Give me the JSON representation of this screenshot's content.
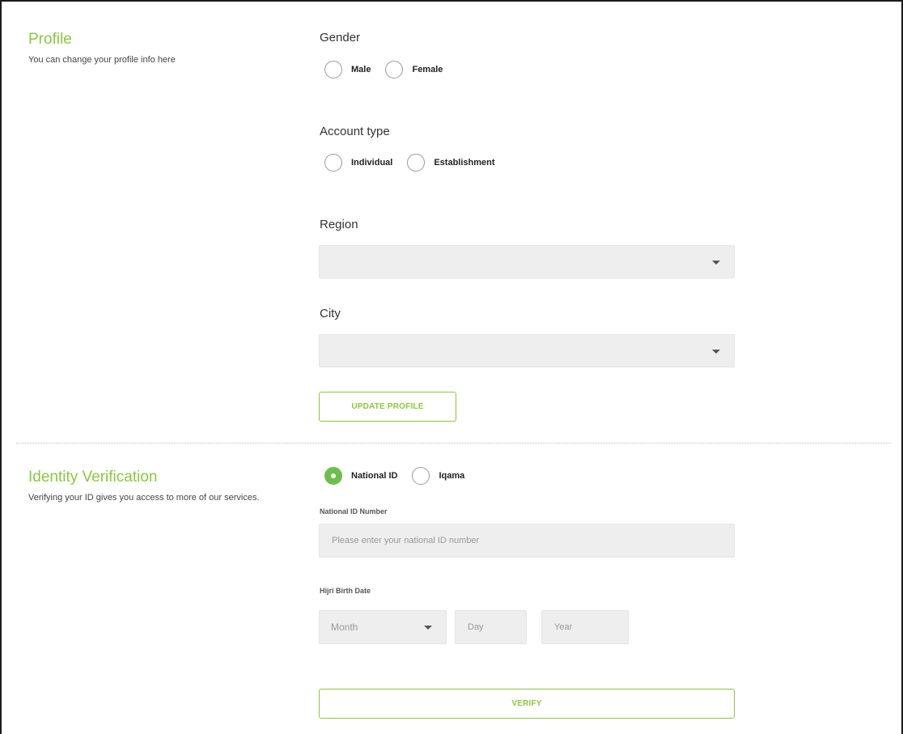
{
  "profile": {
    "title": "Profile",
    "description": "You can change your profile info here",
    "gender": {
      "label": "Gender",
      "options": [
        {
          "label": "Male",
          "checked": false
        },
        {
          "label": "Female",
          "checked": false
        }
      ]
    },
    "account_type": {
      "label": "Account type",
      "options": [
        {
          "label": "Individual",
          "checked": false
        },
        {
          "label": "Establishment",
          "checked": false
        }
      ]
    },
    "region": {
      "label": "Region",
      "value": ""
    },
    "city": {
      "label": "City",
      "value": ""
    },
    "update_button": "UPDATE PROFILE"
  },
  "identity": {
    "title": "Identity Verification",
    "description": "Verifying your ID gives you access to more of our services.",
    "id_type": {
      "options": [
        {
          "label": "National ID",
          "checked": true
        },
        {
          "label": "Iqama",
          "checked": false
        }
      ]
    },
    "national_id": {
      "label": "National ID Number",
      "placeholder": "Please enter your national ID number",
      "value": ""
    },
    "birth_date": {
      "label": "Hijri Birth Date",
      "month_placeholder": "Month",
      "day_placeholder": "Day",
      "year_placeholder": "Year"
    },
    "verify_button": "VERIFY"
  },
  "colors": {
    "accent": "#8cc63f",
    "radio_checked": "#6cc04a",
    "field_bg": "#eeeeee"
  }
}
